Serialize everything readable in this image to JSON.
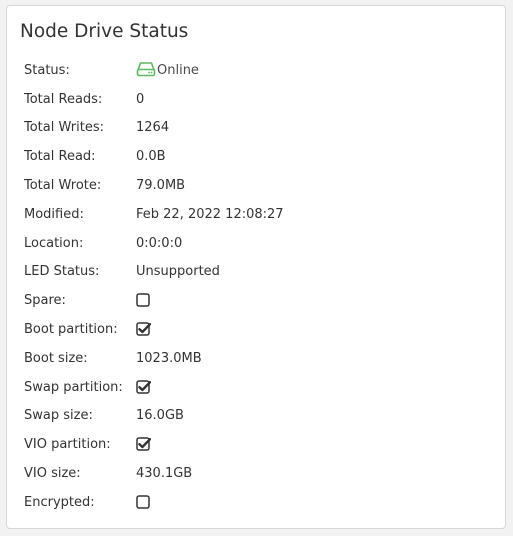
{
  "panel": {
    "title": "Node Drive Status"
  },
  "status_color": "#5cb85c",
  "rows": {
    "status": {
      "label": "Status:",
      "value": "Online",
      "icon": "hard-drive-icon"
    },
    "total_reads": {
      "label": "Total Reads:",
      "value": "0"
    },
    "total_writes": {
      "label": "Total Writes:",
      "value": "1264"
    },
    "total_read": {
      "label": "Total Read:",
      "value": "0.0B"
    },
    "total_wrote": {
      "label": "Total Wrote:",
      "value": "79.0MB"
    },
    "modified": {
      "label": "Modified:",
      "value": "Feb 22, 2022 12:08:27"
    },
    "location": {
      "label": "Location:",
      "value": "0:0:0:0"
    },
    "led_status": {
      "label": "LED Status:",
      "value": "Unsupported"
    },
    "spare": {
      "label": "Spare:",
      "checked": false
    },
    "boot_partition": {
      "label": "Boot partition:",
      "checked": true
    },
    "boot_size": {
      "label": "Boot size:",
      "value": "1023.0MB"
    },
    "swap_partition": {
      "label": "Swap partition:",
      "checked": true
    },
    "swap_size": {
      "label": "Swap size:",
      "value": "16.0GB"
    },
    "vio_partition": {
      "label": "VIO partition:",
      "checked": true
    },
    "vio_size": {
      "label": "VIO size:",
      "value": "430.1GB"
    },
    "encrypted": {
      "label": "Encrypted:",
      "checked": false
    }
  }
}
